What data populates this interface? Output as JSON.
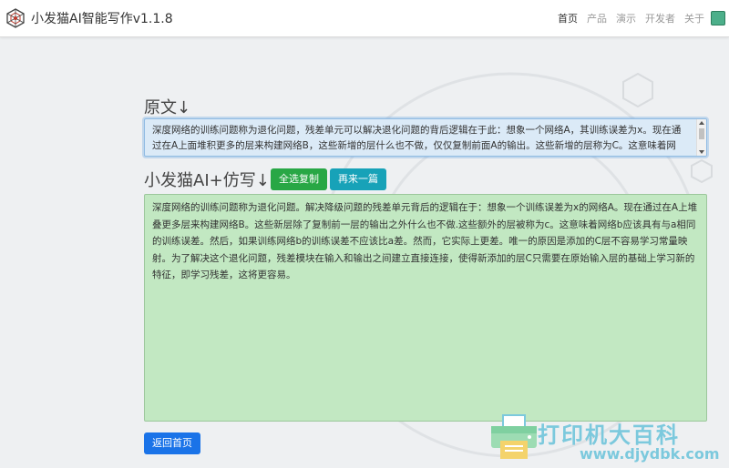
{
  "header": {
    "brand_title": "小发猫AI智能写作v1.1.8",
    "nav": [
      {
        "label": "首页",
        "active": true
      },
      {
        "label": "产品",
        "active": false
      },
      {
        "label": "演示",
        "active": false
      },
      {
        "label": "开发者",
        "active": false
      },
      {
        "label": "关于",
        "active": false
      }
    ]
  },
  "original": {
    "label": "原文↓",
    "text": "深度网络的训练问题称为退化问题，残差单元可以解决退化问题的背后逻辑在于此：想象一个网络A，其训练误差为x。现在通过在A上面堆积更多的层来构建网络B，这些新增的层什么也不做，仅仅复制前面A的输出。这些新增的层称为C。这意味着网"
  },
  "rewrite": {
    "label": "小发猫AI+仿写↓",
    "select_all_button": "全选复制",
    "again_button": "再来一篇",
    "text": "深度网络的训练问题称为退化问题。解决降级问题的残差单元背后的逻辑在于：想象一个训练误差为x的网络A。现在通过在A上堆叠更多层来构建网络B。这些新层除了复制前一层的输出之外什么也不做.这些额外的层被称为c。这意味着网络b应该具有与a相同的训练误差。然后，如果训练网络b的训练误差不应该比a差。然而，它实际上更差。唯一的原因是添加的C层不容易学习常量映射。为了解决这个退化问题，残差模块在输入和输出之间建立直接连接，使得新添加的层C只需要在原始输入层的基础上学习新的特征，即学习残差，这将更容易。"
  },
  "back_button": "返回首页",
  "watermark": {
    "title": "打印机大百科",
    "url": "www.djydbk.com"
  },
  "colors": {
    "accent_green": "#28a745",
    "accent_teal": "#17a2b8",
    "accent_blue": "#1a73e8",
    "result_bg": "#c2e8c2",
    "original_bg": "#dbeaf7"
  }
}
